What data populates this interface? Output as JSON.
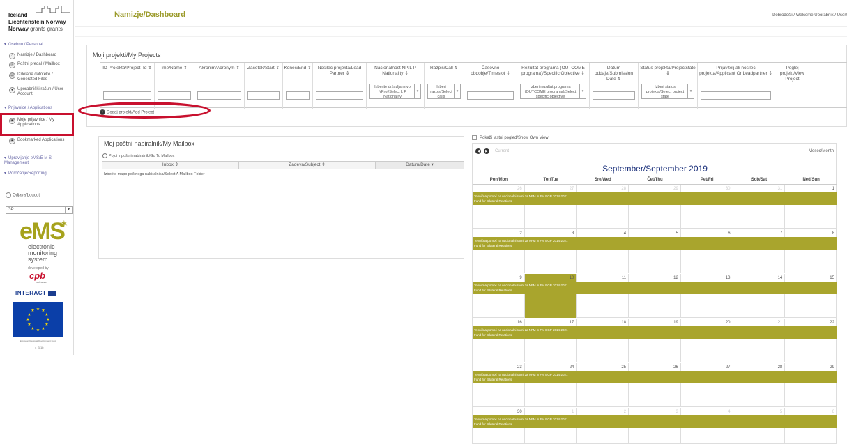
{
  "header": {
    "title": "Namizje/Dashboard",
    "welcome": "Dobrodošli / Welcome Uporabnik / User!"
  },
  "logo": {
    "line1": "Iceland",
    "line2": "Liechtenstein  Norway",
    "line3_a": "Norway",
    "line3_b": "grants  grants"
  },
  "sidebar": {
    "section_personal": "Osebno / Personal",
    "items_personal": [
      {
        "icon": "home-icon",
        "label": "Namizje / Dashboard"
      },
      {
        "icon": "mail-icon",
        "label": "Poštni predal / Mailbox"
      },
      {
        "icon": "file-icon",
        "label": "Izdelane datoteke / Generated Files"
      },
      {
        "icon": "user-icon",
        "label": "Uporabniški račun / User Account"
      }
    ],
    "section_applications": "Prijavnice / Applications",
    "items_applications": [
      {
        "icon": "document-icon",
        "label": "Moje prijavnice / My Applications"
      },
      {
        "icon": "bookmark-icon",
        "label": "Bookmarked Applications"
      }
    ],
    "section_management": "Upravljanje eMS/E M S Management",
    "section_reporting": "Poročanje/Reporting",
    "logout": "Odjava/Logout",
    "language": "GP",
    "developed_by": "developed by",
    "cpb": "cpb",
    "cpb_sub": "software",
    "interact": "INTERACT",
    "eu_caption": "European Regional Development Fund",
    "version": "4_3-1b"
  },
  "ems": {
    "big": "eMS",
    "sub1": "electronic",
    "sub2": "monitoring",
    "sub3": "system"
  },
  "projects": {
    "title": "Moji projekti/My Projects",
    "columns": [
      {
        "label": "ID Projekta/Project_Id ⇕",
        "filter": "input"
      },
      {
        "label": "Ime/Name ⇕",
        "filter": "input"
      },
      {
        "label": "Akronim/Acronym ⇕",
        "filter": "input"
      },
      {
        "label": "Začetek/Start ⇕",
        "filter": "input"
      },
      {
        "label": "Konec/End ⇕",
        "filter": "input"
      },
      {
        "label": "Nosilec projekta/Lead Partner ⇕",
        "filter": "input"
      },
      {
        "label": "Nacionalnost NP/L P Nationality ⇕",
        "filter": "select",
        "option": "Izberite državljanstvo NProj/Select L P Nationality"
      },
      {
        "label": "Razpis/Call ⇕",
        "filter": "select",
        "option": "Izberi razpis/Select calls"
      },
      {
        "label": "Časovno obdobje/Timeslot ⇕",
        "filter": "input"
      },
      {
        "label": "Rezultat programa (OUTCOME programa)/Specific Objective ⇕",
        "filter": "select",
        "option": "Izberi rezultat programa (OUTCOME programa)/Select specific objective"
      },
      {
        "label": "Datum oddaje/Submission Date ⇕",
        "filter": "input"
      },
      {
        "label": "Status projekta/Projectstate ⇕",
        "filter": "select",
        "option": "Izberi status projekta/Select project state"
      },
      {
        "label": "Prijavitelj ali nosilec projekta/Applicant Or Leadpartner ⇕",
        "filter": "input"
      },
      {
        "label": "Poglej projekt/View Project",
        "filter": "none"
      }
    ],
    "add_project": "Dodaj projekt/Add Project"
  },
  "mailbox": {
    "title": "Moj poštni nabiralnik/My Mailbox",
    "goto": "Pojdi v poštni nabiralnik/Go To Mailbox",
    "columns": [
      "Inbox ⇕",
      "Zadeva/Subject ⇕",
      "Datum/Date ▾"
    ],
    "empty_row": "Izberite mapo poštnega nabiralnika/Select A Mailbox Folder"
  },
  "calendar": {
    "own_view": "Pokaži lastni pogled/Show Own View",
    "current": "Current",
    "view": "Mesec/Month",
    "title": "September/September 2019",
    "days": [
      "Pon/Mon",
      "Tor/Tue",
      "Sre/Wed",
      "Čet/Thu",
      "Pet/Fri",
      "Sob/Sat",
      "Ned/Sun"
    ],
    "weeks": [
      [
        {
          "d": "26",
          "o": true
        },
        {
          "d": "27",
          "o": true
        },
        {
          "d": "28",
          "o": true
        },
        {
          "d": "29",
          "o": true
        },
        {
          "d": "30",
          "o": true
        },
        {
          "d": "31",
          "o": true
        },
        {
          "d": "1"
        }
      ],
      [
        {
          "d": "2"
        },
        {
          "d": "3"
        },
        {
          "d": "4"
        },
        {
          "d": "5"
        },
        {
          "d": "6"
        },
        {
          "d": "7"
        },
        {
          "d": "8"
        }
      ],
      [
        {
          "d": "9"
        },
        {
          "d": "10",
          "t": true
        },
        {
          "d": "11"
        },
        {
          "d": "12"
        },
        {
          "d": "13"
        },
        {
          "d": "14"
        },
        {
          "d": "15"
        }
      ],
      [
        {
          "d": "16"
        },
        {
          "d": "17"
        },
        {
          "d": "18"
        },
        {
          "d": "19"
        },
        {
          "d": "20"
        },
        {
          "d": "21"
        },
        {
          "d": "22"
        }
      ],
      [
        {
          "d": "23"
        },
        {
          "d": "24"
        },
        {
          "d": "25"
        },
        {
          "d": "26"
        },
        {
          "d": "27"
        },
        {
          "d": "28"
        },
        {
          "d": "29"
        }
      ],
      [
        {
          "d": "30"
        },
        {
          "d": "1",
          "o": true
        },
        {
          "d": "2",
          "o": true
        },
        {
          "d": "3",
          "o": true
        },
        {
          "d": "4",
          "o": true
        },
        {
          "d": "5",
          "o": true
        },
        {
          "d": "6",
          "o": true
        }
      ]
    ],
    "event_line1": "Tehnična pomoč na nacionalni ravni za NFM in FM EGP 2014-2021",
    "event_line2": "Fund for Bilateral Relations"
  },
  "colors": {
    "accent": "#a9a52d",
    "title": "#9b9a2a",
    "highlight": "#c8102e",
    "calendar_title": "#1a2f7a"
  }
}
